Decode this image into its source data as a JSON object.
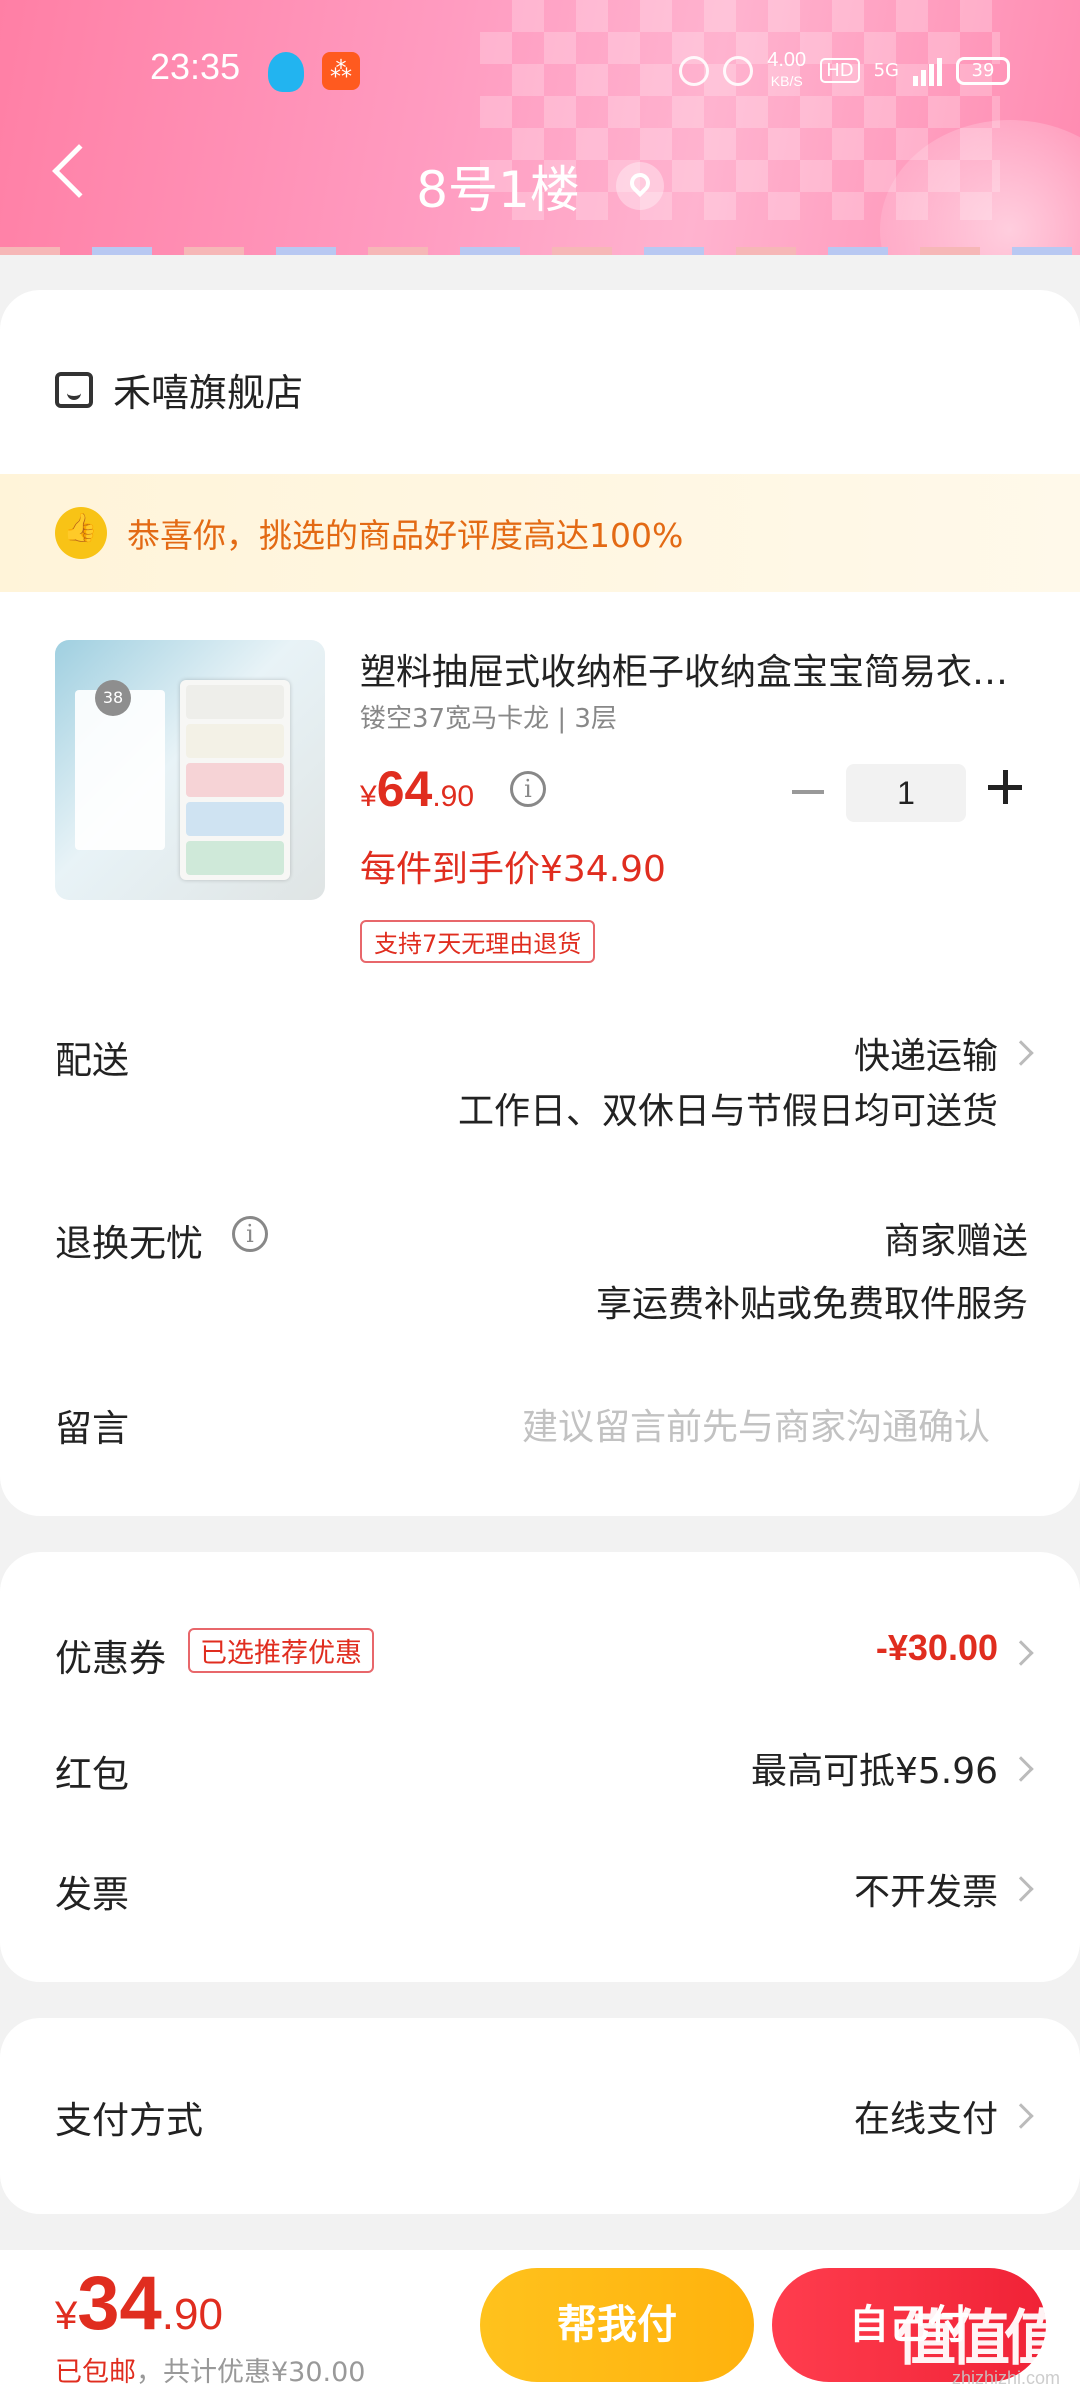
{
  "status_bar": {
    "time": "23:35",
    "speed": "4.00",
    "speed_unit": "KB/S",
    "hd": "HD",
    "network": "5G",
    "battery": "39"
  },
  "header": {
    "title": "8号1楼"
  },
  "store": {
    "name": "禾嘻旗舰店"
  },
  "banner": {
    "text": "恭喜你，挑选的商品好评度高达100%"
  },
  "product": {
    "image_badge": "38",
    "title": "塑料抽屉式收纳柜子收纳盒宝宝简易衣柜储物柜",
    "spec": "镂空37宽马卡龙 | 3层",
    "price_currency": "¥",
    "price_int": "64",
    "price_dec": ".90",
    "quantity": "1",
    "final_price": "每件到手价¥34.90",
    "return_tag": "支持7天无理由退货"
  },
  "shipping": {
    "label": "配送",
    "method": "快递运输",
    "note": "工作日、双休日与节假日均可送货"
  },
  "returns": {
    "label": "退换无忧",
    "value": "商家赠送",
    "note": "享运费补贴或免费取件服务"
  },
  "message": {
    "label": "留言",
    "placeholder": "建议留言前先与商家沟通确认"
  },
  "coupon": {
    "label": "优惠券",
    "tag": "已选推荐优惠",
    "value": "-¥30.00"
  },
  "red_packet": {
    "label": "红包",
    "value": "最高可抵¥5.96"
  },
  "invoice": {
    "label": "发票",
    "value": "不开发票"
  },
  "payment": {
    "label": "支付方式",
    "value": "在线支付"
  },
  "bottom": {
    "currency": "¥",
    "total_int": "34",
    "total_dec": ".90",
    "free_shipping": "已包邮",
    "discount_note": "，共计优惠¥30.00",
    "help_pay": "帮我付",
    "self_pay": "自己付",
    "watermark": "值值值",
    "watermark_sub": "zhizhizhi.com"
  },
  "colors": {
    "accent": "#e02d1f",
    "header_pink": "#ff8fb4",
    "help_button": "#ffb20d",
    "pay_button": "#f02236"
  }
}
